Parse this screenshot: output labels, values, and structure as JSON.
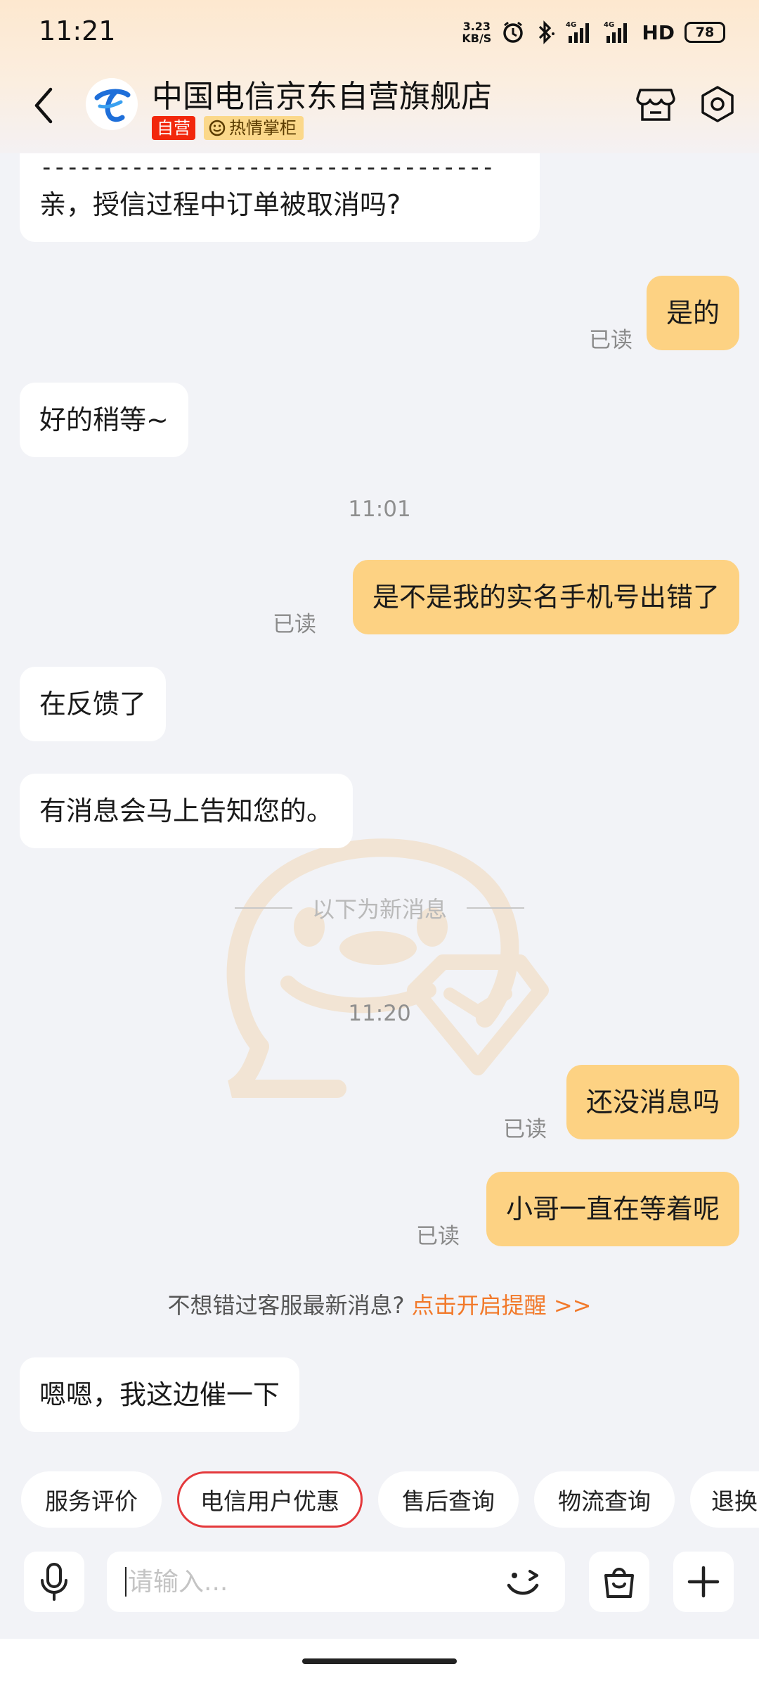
{
  "status_bar": {
    "time": "11:21",
    "net_speed_value": "3.23",
    "net_speed_unit": "KB/S",
    "network_type": "4G",
    "hd_label": "HD",
    "battery": "78"
  },
  "header": {
    "shop_name": "中国电信京东自营旗舰店",
    "tag_self": "自营",
    "tag_hot": "热情掌柜"
  },
  "messages": {
    "m1_dashes": "-----------------------------------",
    "m1_text": "亲，授信过程中订单被取消吗?",
    "m2_text": "是的",
    "m2_read": "已读",
    "m3_text": "好的稍等~",
    "ts1": "11:01",
    "m4_text": "是不是我的实名手机号出错了",
    "m4_read": "已读",
    "m5_text": "在反馈了",
    "m6_text": "有消息会马上告知您的。",
    "divider": "以下为新消息",
    "ts2": "11:20",
    "m7_text": "还没消息吗",
    "m7_read": "已读",
    "m8_text": "小哥一直在等着呢",
    "m8_read": "已读",
    "notice_text": "不想错过客服最新消息?",
    "notice_link": "点击开启提醒 >>",
    "m9_text": "嗯嗯，我这边催一下"
  },
  "chips": {
    "c1": "服务评价",
    "c2": "电信用户优惠",
    "c3": "售后查询",
    "c4": "物流查询",
    "c5": "退换"
  },
  "input": {
    "placeholder": "请输入..."
  },
  "colors": {
    "outgoing_bubble": "#fdd283",
    "incoming_bubble": "#ffffff",
    "link": "#f2792a",
    "active_chip_border": "#e4393c",
    "tag_self": "#f2270c",
    "telecom_blue": "#1f6fd9"
  }
}
